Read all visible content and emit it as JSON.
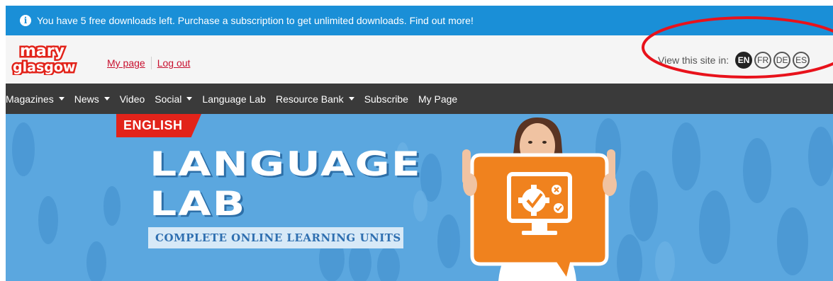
{
  "notice": {
    "text": "You have 5 free downloads left. Purchase a subscription to get unlimited downloads. Find out more!",
    "icon": "info-icon",
    "color": "#1a8fd7"
  },
  "header": {
    "logo": {
      "line1": "mary",
      "line2": "glasgow",
      "color": "#e2231a"
    },
    "links": [
      {
        "label": "My page"
      },
      {
        "label": "Log out"
      }
    ],
    "lang_label": "View this site in:",
    "languages": [
      {
        "code": "EN",
        "active": true
      },
      {
        "code": "FR",
        "active": false
      },
      {
        "code": "DE",
        "active": false
      },
      {
        "code": "ES",
        "active": false
      }
    ]
  },
  "nav": {
    "items": [
      {
        "label": "Magazines",
        "dropdown": true
      },
      {
        "label": "News",
        "dropdown": true
      },
      {
        "label": "Video",
        "dropdown": false
      },
      {
        "label": "Social",
        "dropdown": true
      },
      {
        "label": "Language Lab",
        "dropdown": false
      },
      {
        "label": "Resource Bank",
        "dropdown": true
      },
      {
        "label": "Subscribe",
        "dropdown": false
      },
      {
        "label": "My Page",
        "dropdown": false
      }
    ]
  },
  "hero": {
    "tag": "ENGLISH",
    "title_line1": "LANGUAGE",
    "title_line2": "LAB",
    "subtitle": "COMPLETE ONLINE LEARNING UNITS",
    "accent_color": "#f0821e",
    "background_color": "#5ba7df"
  }
}
